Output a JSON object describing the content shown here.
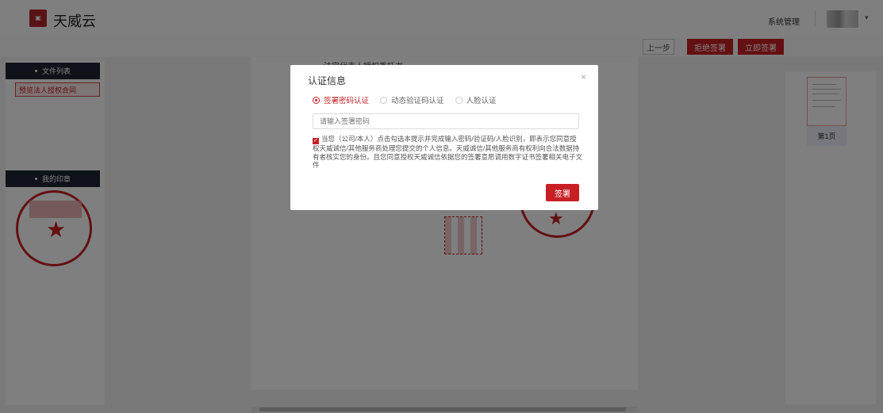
{
  "app": {
    "logo_glyph": "诚天\n信威",
    "title": "天威云"
  },
  "header": {
    "system_manage": "系统管理",
    "avatar_caret": "▾"
  },
  "actions": {
    "prev": "上一步",
    "reject": "拒绝签署",
    "sign_now": "立即签署"
  },
  "left": {
    "file_list_title": "文件列表",
    "files": [
      "预览法人授权合同"
    ],
    "seals_title": "我的印章"
  },
  "document": {
    "title_fragment": "法定代表人授权委托书"
  },
  "thumbnail": {
    "page_label": "第1页"
  },
  "modal": {
    "title": "认证信息",
    "close": "×",
    "options": [
      {
        "label": "签署密码认证",
        "selected": true
      },
      {
        "label": "动态验证码认证",
        "selected": false
      },
      {
        "label": "人脸认证",
        "selected": false
      }
    ],
    "password_placeholder": "请输入签署密码",
    "consent_checked": true,
    "consent_text": "当您（公司/本人）点击勾选本提示并完成输入密码/验证码/人脸识别，即表示您同意授权天威诚信/其他服务商处理您提交的个人信息。天威诚信/其他服务商有权利向合法数据持有者核实您的身份。且您同意授权天威诚信依据您的签署意愿调用数字证书签署相关电子文件",
    "sign_button": "签署"
  },
  "colors": {
    "accent": "#c81f25",
    "panel_header": "#1f2633"
  }
}
